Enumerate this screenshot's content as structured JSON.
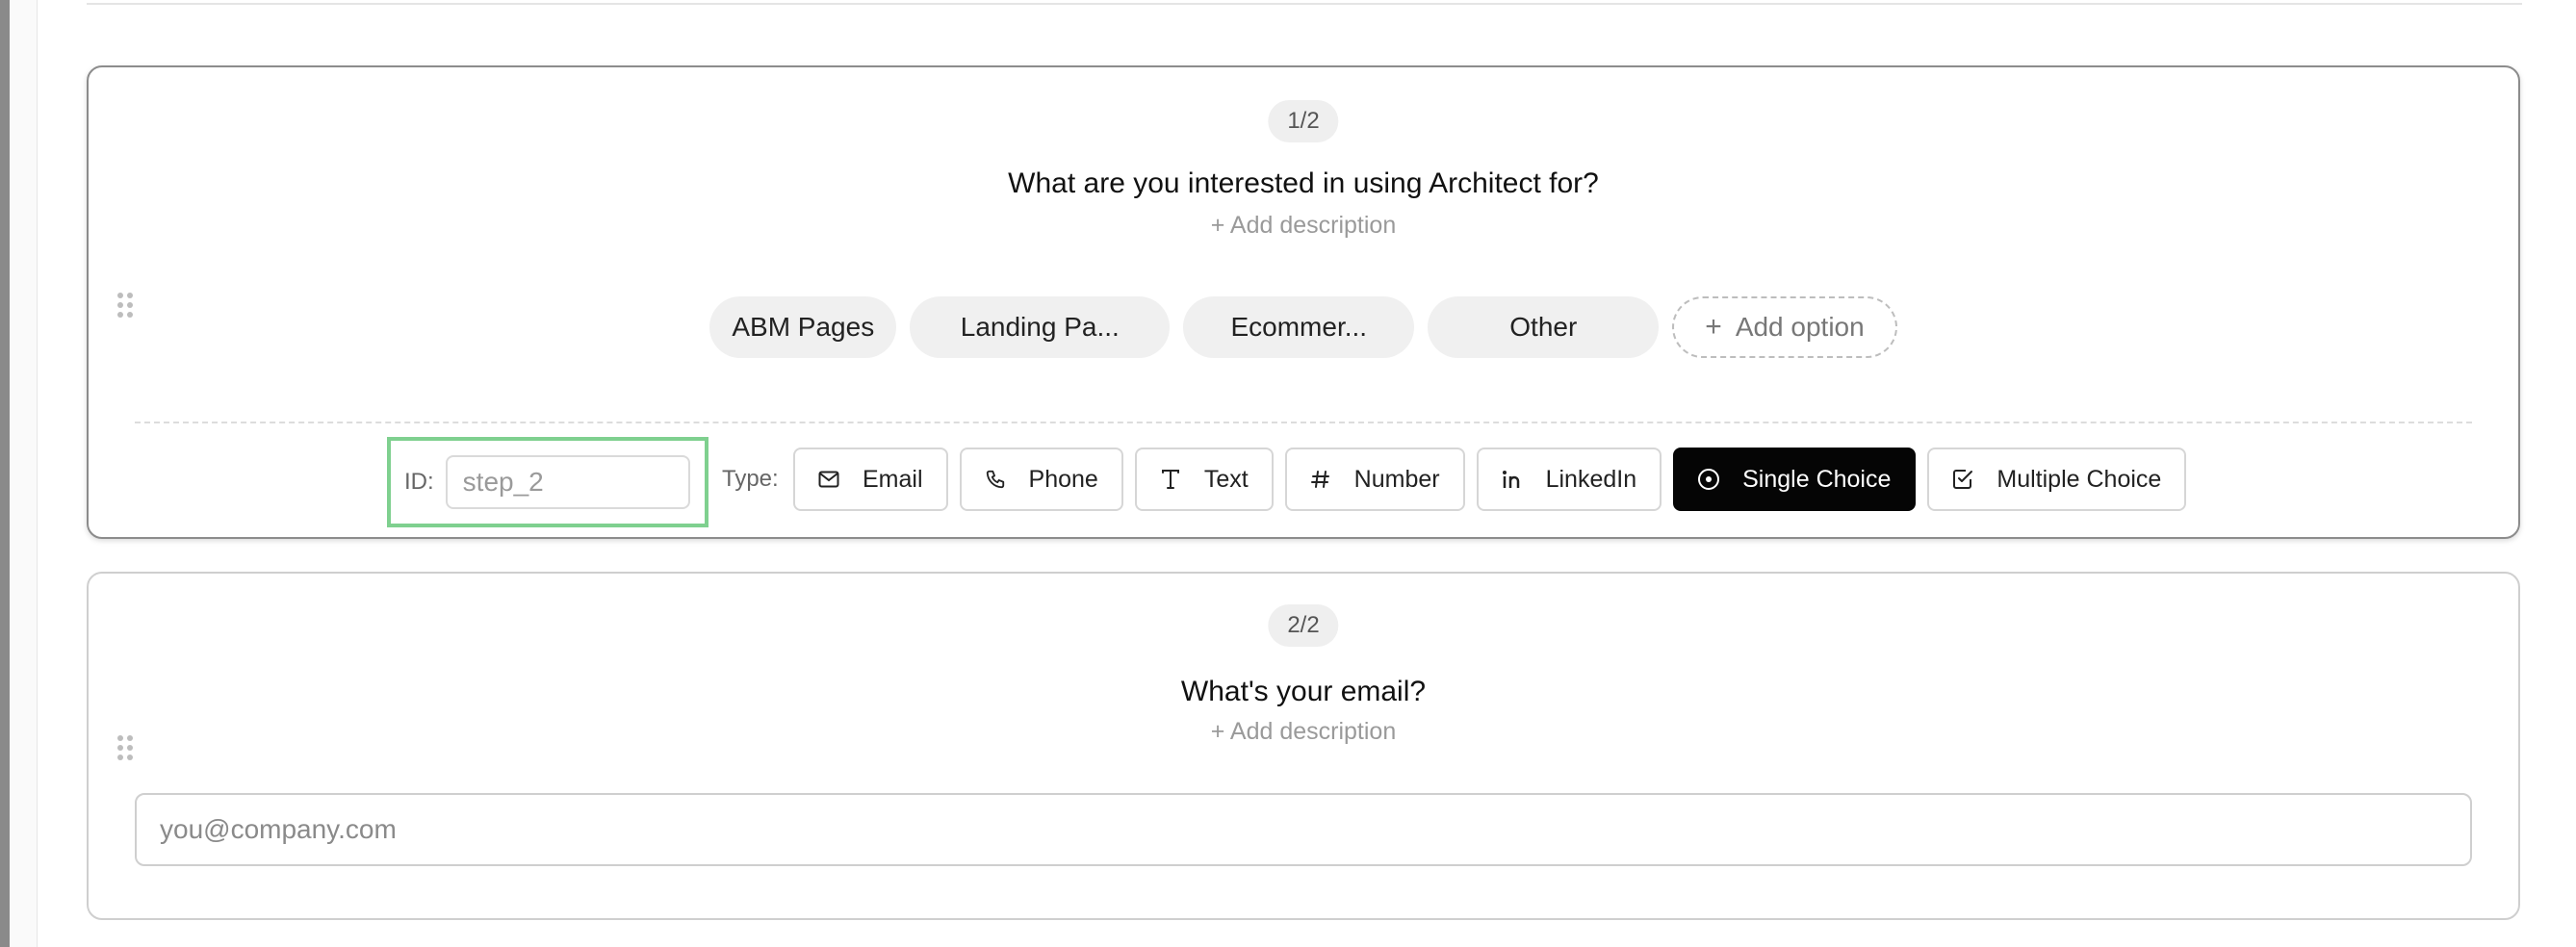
{
  "steps": [
    {
      "badge": "1/2",
      "question": "What are you interested in using Architect for?",
      "add_description": "+ Add description",
      "options": [
        "ABM Pages",
        "Landing Pa...",
        "Ecommer...",
        "Other"
      ],
      "add_option": "Add option",
      "id_label": "ID:",
      "id_placeholder": "step_2",
      "type_label": "Type:",
      "types": [
        {
          "label": "Email",
          "icon": "mail-icon"
        },
        {
          "label": "Phone",
          "icon": "phone-icon"
        },
        {
          "label": "Text",
          "icon": "text-icon"
        },
        {
          "label": "Number",
          "icon": "hash-icon"
        },
        {
          "label": "LinkedIn",
          "icon": "linkedin-icon"
        },
        {
          "label": "Single Choice",
          "icon": "radio-icon",
          "active": true
        },
        {
          "label": "Multiple Choice",
          "icon": "checkbox-icon"
        }
      ]
    },
    {
      "badge": "2/2",
      "question": "What's your email?",
      "add_description": "+ Add description",
      "input_placeholder": "you@company.com"
    }
  ],
  "colors": {
    "active_type_bg": "#050505",
    "id_highlight": "#7fd08f",
    "card_border": "#8c8c8c"
  }
}
